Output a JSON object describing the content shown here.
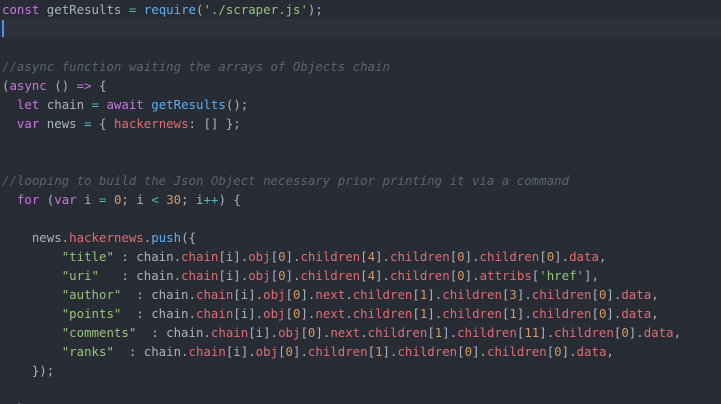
{
  "editor": {
    "theme_colors": {
      "background": "#282c34",
      "keyword": "#c678dd",
      "plain": "#abb2bf",
      "variable": "#e06c75",
      "function": "#61afef",
      "string": "#98c379",
      "number": "#d19a66",
      "comment": "#5c6370",
      "operator": "#56b6c2",
      "cursor": "#528bff"
    },
    "active_line": 1,
    "lines": [
      [
        [
          "k",
          "const"
        ],
        [
          "p",
          " getResults "
        ],
        [
          "o",
          "="
        ],
        [
          "p",
          " "
        ],
        [
          "f",
          "require"
        ],
        [
          "p",
          "("
        ],
        [
          "s",
          "'./scraper.js'"
        ],
        [
          "p",
          ");"
        ]
      ],
      [],
      [],
      [
        [
          "c",
          "//async function waiting the arrays of Objects chain"
        ]
      ],
      [
        [
          "p",
          "("
        ],
        [
          "k",
          "async"
        ],
        [
          "p",
          " () "
        ],
        [
          "k",
          "=>"
        ],
        [
          "p",
          " {"
        ]
      ],
      [
        [
          "p",
          "  "
        ],
        [
          "k",
          "let"
        ],
        [
          "p",
          " chain "
        ],
        [
          "o",
          "="
        ],
        [
          "p",
          " "
        ],
        [
          "k",
          "await"
        ],
        [
          "p",
          " "
        ],
        [
          "f",
          "getResults"
        ],
        [
          "p",
          "();"
        ]
      ],
      [
        [
          "p",
          "  "
        ],
        [
          "k",
          "var"
        ],
        [
          "p",
          " news "
        ],
        [
          "o",
          "="
        ],
        [
          "p",
          " { "
        ],
        [
          "v",
          "hackernews"
        ],
        [
          "p",
          ": [] };"
        ]
      ],
      [],
      [],
      [
        [
          "c",
          "//looping to build the Json Object necessary prior printing it via a command"
        ]
      ],
      [
        [
          "p",
          "  "
        ],
        [
          "k",
          "for"
        ],
        [
          "p",
          " ("
        ],
        [
          "k",
          "var"
        ],
        [
          "p",
          " i "
        ],
        [
          "o",
          "="
        ],
        [
          "p",
          " "
        ],
        [
          "n",
          "0"
        ],
        [
          "p",
          "; i "
        ],
        [
          "o",
          "<"
        ],
        [
          "p",
          " "
        ],
        [
          "n",
          "30"
        ],
        [
          "p",
          "; i"
        ],
        [
          "o",
          "++"
        ],
        [
          "p",
          ") {"
        ]
      ],
      [],
      [
        [
          "p",
          "    news."
        ],
        [
          "v",
          "hackernews"
        ],
        [
          "p",
          "."
        ],
        [
          "f",
          "push"
        ],
        [
          "p",
          "({"
        ]
      ],
      [
        [
          "p",
          "        "
        ],
        [
          "s",
          "\"title\""
        ],
        [
          "p",
          " : chain."
        ],
        [
          "v",
          "chain"
        ],
        [
          "p",
          "[i]."
        ],
        [
          "v",
          "obj"
        ],
        [
          "p",
          "["
        ],
        [
          "n",
          "0"
        ],
        [
          "p",
          "]."
        ],
        [
          "v",
          "children"
        ],
        [
          "p",
          "["
        ],
        [
          "n",
          "4"
        ],
        [
          "p",
          "]."
        ],
        [
          "v",
          "children"
        ],
        [
          "p",
          "["
        ],
        [
          "n",
          "0"
        ],
        [
          "p",
          "]."
        ],
        [
          "v",
          "children"
        ],
        [
          "p",
          "["
        ],
        [
          "n",
          "0"
        ],
        [
          "p",
          "]."
        ],
        [
          "v",
          "data"
        ],
        [
          "p",
          ","
        ]
      ],
      [
        [
          "p",
          "        "
        ],
        [
          "s",
          "\"uri\""
        ],
        [
          "p",
          "   : chain."
        ],
        [
          "v",
          "chain"
        ],
        [
          "p",
          "[i]."
        ],
        [
          "v",
          "obj"
        ],
        [
          "p",
          "["
        ],
        [
          "n",
          "0"
        ],
        [
          "p",
          "]."
        ],
        [
          "v",
          "children"
        ],
        [
          "p",
          "["
        ],
        [
          "n",
          "4"
        ],
        [
          "p",
          "]."
        ],
        [
          "v",
          "children"
        ],
        [
          "p",
          "["
        ],
        [
          "n",
          "0"
        ],
        [
          "p",
          "]."
        ],
        [
          "v",
          "attribs"
        ],
        [
          "p",
          "["
        ],
        [
          "s",
          "'href'"
        ],
        [
          "p",
          "],"
        ]
      ],
      [
        [
          "p",
          "        "
        ],
        [
          "s",
          "\"author\""
        ],
        [
          "p",
          "  : chain."
        ],
        [
          "v",
          "chain"
        ],
        [
          "p",
          "[i]."
        ],
        [
          "v",
          "obj"
        ],
        [
          "p",
          "["
        ],
        [
          "n",
          "0"
        ],
        [
          "p",
          "]."
        ],
        [
          "v",
          "next"
        ],
        [
          "p",
          "."
        ],
        [
          "v",
          "children"
        ],
        [
          "p",
          "["
        ],
        [
          "n",
          "1"
        ],
        [
          "p",
          "]."
        ],
        [
          "v",
          "children"
        ],
        [
          "p",
          "["
        ],
        [
          "n",
          "3"
        ],
        [
          "p",
          "]."
        ],
        [
          "v",
          "children"
        ],
        [
          "p",
          "["
        ],
        [
          "n",
          "0"
        ],
        [
          "p",
          "]."
        ],
        [
          "v",
          "data"
        ],
        [
          "p",
          ","
        ]
      ],
      [
        [
          "p",
          "        "
        ],
        [
          "s",
          "\"points\""
        ],
        [
          "p",
          "  : chain."
        ],
        [
          "v",
          "chain"
        ],
        [
          "p",
          "[i]."
        ],
        [
          "v",
          "obj"
        ],
        [
          "p",
          "["
        ],
        [
          "n",
          "0"
        ],
        [
          "p",
          "]."
        ],
        [
          "v",
          "next"
        ],
        [
          "p",
          "."
        ],
        [
          "v",
          "children"
        ],
        [
          "p",
          "["
        ],
        [
          "n",
          "1"
        ],
        [
          "p",
          "]."
        ],
        [
          "v",
          "children"
        ],
        [
          "p",
          "["
        ],
        [
          "n",
          "1"
        ],
        [
          "p",
          "]."
        ],
        [
          "v",
          "children"
        ],
        [
          "p",
          "["
        ],
        [
          "n",
          "0"
        ],
        [
          "p",
          "]."
        ],
        [
          "v",
          "data"
        ],
        [
          "p",
          ","
        ]
      ],
      [
        [
          "p",
          "        "
        ],
        [
          "s",
          "\"comments\""
        ],
        [
          "p",
          "  : chain."
        ],
        [
          "v",
          "chain"
        ],
        [
          "p",
          "[i]."
        ],
        [
          "v",
          "obj"
        ],
        [
          "p",
          "["
        ],
        [
          "n",
          "0"
        ],
        [
          "p",
          "]."
        ],
        [
          "v",
          "next"
        ],
        [
          "p",
          "."
        ],
        [
          "v",
          "children"
        ],
        [
          "p",
          "["
        ],
        [
          "n",
          "1"
        ],
        [
          "p",
          "]."
        ],
        [
          "v",
          "children"
        ],
        [
          "p",
          "["
        ],
        [
          "n",
          "11"
        ],
        [
          "p",
          "]."
        ],
        [
          "v",
          "children"
        ],
        [
          "p",
          "["
        ],
        [
          "n",
          "0"
        ],
        [
          "p",
          "]."
        ],
        [
          "v",
          "data"
        ],
        [
          "p",
          ","
        ]
      ],
      [
        [
          "p",
          "        "
        ],
        [
          "s",
          "\"ranks\""
        ],
        [
          "p",
          "  : chain."
        ],
        [
          "v",
          "chain"
        ],
        [
          "p",
          "[i]."
        ],
        [
          "v",
          "obj"
        ],
        [
          "p",
          "["
        ],
        [
          "n",
          "0"
        ],
        [
          "p",
          "]."
        ],
        [
          "v",
          "children"
        ],
        [
          "p",
          "["
        ],
        [
          "n",
          "1"
        ],
        [
          "p",
          "]."
        ],
        [
          "v",
          "children"
        ],
        [
          "p",
          "["
        ],
        [
          "n",
          "0"
        ],
        [
          "p",
          "]."
        ],
        [
          "v",
          "children"
        ],
        [
          "p",
          "["
        ],
        [
          "n",
          "0"
        ],
        [
          "p",
          "]."
        ],
        [
          "v",
          "data"
        ],
        [
          "p",
          ","
        ]
      ],
      [
        [
          "p",
          "    });"
        ]
      ],
      [],
      [
        [
          "p",
          "  }"
        ]
      ]
    ]
  }
}
